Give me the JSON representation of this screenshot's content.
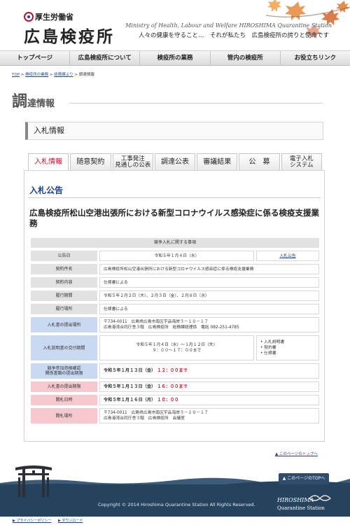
{
  "header": {
    "ministry": "厚生労働省",
    "site_title": "広島検疫所",
    "tagline_en": "Ministry of Health, Labour and Welfare  HIROSHIMA Quarantine Station",
    "tagline_jp": "人々の健康を守ること…　それが私たち　広島検疫所の誇りと使命です"
  },
  "nav": [
    "トップページ",
    "広島検疫所について",
    "検疫所の業務",
    "管内の検疫所",
    "お役立ちリンク"
  ],
  "breadcrumb": {
    "items": [
      "TOP",
      "検疫所の業務",
      "総務課より",
      "調達情報"
    ],
    "sep": " > "
  },
  "section": {
    "first_char": "調",
    "rest": "達情報"
  },
  "subhead": "入札情報",
  "tabs": [
    {
      "line1": "入札情報",
      "line2": ""
    },
    {
      "line1": "随意契約",
      "line2": ""
    },
    {
      "line1": "工事発注",
      "line2": "見通しの公表"
    },
    {
      "line1": "調達公表",
      "line2": ""
    },
    {
      "line1": "審議結果",
      "line2": ""
    },
    {
      "line1": "公　募",
      "line2": ""
    },
    {
      "line1": "電子入札",
      "line2": "システム"
    }
  ],
  "bid": {
    "heading": "入札公告",
    "title": "広島検疫所松山空港出張所における新型コロナウイルス感染症に係る検疫支援業務"
  },
  "table": {
    "header": "競争入札に関する事項",
    "notice_date_label": "公告日",
    "notice_date": "令和５年１月４日（水）",
    "notice_link": "入札公告",
    "contract_name_label": "契約件名",
    "contract_name": "広島検疫所松山空港出張所における新型コロナウイルス感染症に係る検疫支援業務",
    "contract_content_label": "契約内容",
    "contract_content": "仕様書による",
    "period_label": "履行期間",
    "period": "令和５年２月２日（木）、２月３日（金）、２月８日（水）",
    "place_label": "履行場所",
    "place": "仕様書による",
    "submit_label": "入札書の提出場所",
    "submit_line1": "〒734-0011　広島県広島市南区宇品海岸３－１０－１７",
    "submit_line2": "広島港湾合同庁舎３階　広島検疫所　総務課経理係　電話 082-251-4785",
    "dist_label": "入札説明書の交付期間",
    "dist_line1": "令和５年１月４日（水）～１月１２日（木）",
    "dist_line2": "９：００～１７：００まで",
    "docs": [
      "入札説明書",
      "契約書",
      "仕様書"
    ],
    "qual_label_1": "競争参加資格確認",
    "qual_label_2": "関係書類の提出期限",
    "qual_date": "令和５年１月１３日（金）",
    "qual_time": "１２：００まで",
    "bid_deadline_label": "入札書の提出期限",
    "bid_deadline_date": "令和５年１月１３日（金）",
    "bid_deadline_time": "１６：００まで",
    "open_date_label": "開札日時",
    "open_date_date": "令和５年１月１６日（月）",
    "open_date_time": "１０：００",
    "open_place_label": "開札場所",
    "open_place_line1": "〒734-0011　広島県広島市南区宇品海岸３－１０－１７",
    "open_place_line2": "広島港湾合同庁舎３階　広島検疫所　会議室"
  },
  "to_top_link": "▲ このページのトップへ",
  "to_top_button": "▲ このページのTOPへ",
  "footer": {
    "copyright": "Copyright © 2014 Hiroshima Quarantine Station All Rights Reserved.",
    "logo_top": "HIROSHIMA",
    "logo_bottom": "Quarantine Station",
    "links": [
      "▶ プライバシーポリシー",
      "▶ ダウンロード"
    ]
  },
  "colors": {
    "accent_red": "#c8102e",
    "link_blue": "#1a3f93",
    "footer_navy": "#26435e"
  }
}
